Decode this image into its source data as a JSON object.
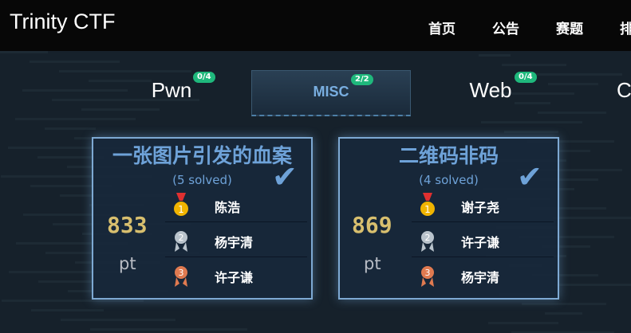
{
  "navbar": {
    "brand": "Trinity CTF",
    "items": [
      "首页",
      "公告",
      "赛题",
      "排"
    ]
  },
  "tabs": [
    {
      "label": "Pwn",
      "badge": "0/4",
      "active": false
    },
    {
      "label": "MISC",
      "badge": "2/2",
      "active": true
    },
    {
      "label": "Web",
      "badge": "0/4",
      "active": false
    },
    {
      "label": "C",
      "badge": "",
      "active": false
    }
  ],
  "cards": [
    {
      "title": "一张图片引发的血案",
      "solved": "(5 solved)",
      "points": "833",
      "unit": "pt",
      "rankings": [
        {
          "medal": "gold-medal-icon",
          "name": "陈浩"
        },
        {
          "medal": "silver-medal-icon",
          "name": "杨宇清"
        },
        {
          "medal": "bronze-medal-icon",
          "name": "许子谦"
        }
      ]
    },
    {
      "title": "二维码非码",
      "solved": "(4 solved)",
      "points": "869",
      "unit": "pt",
      "rankings": [
        {
          "medal": "gold-medal-icon",
          "name": "谢子尧"
        },
        {
          "medal": "silver-medal-icon",
          "name": "许子谦"
        },
        {
          "medal": "bronze-medal-icon",
          "name": "杨宇清"
        }
      ]
    }
  ],
  "colors": {
    "navbar_bg": "#070707",
    "page_bg": "#16212b",
    "accent_blue": "#6ea2d8",
    "badge_green": "#1fb87c",
    "points_gold": "#d8bf6e",
    "medal_gold": "#f0b400",
    "medal_silver": "#b9c3cc",
    "medal_bronze": "#e07a50"
  }
}
